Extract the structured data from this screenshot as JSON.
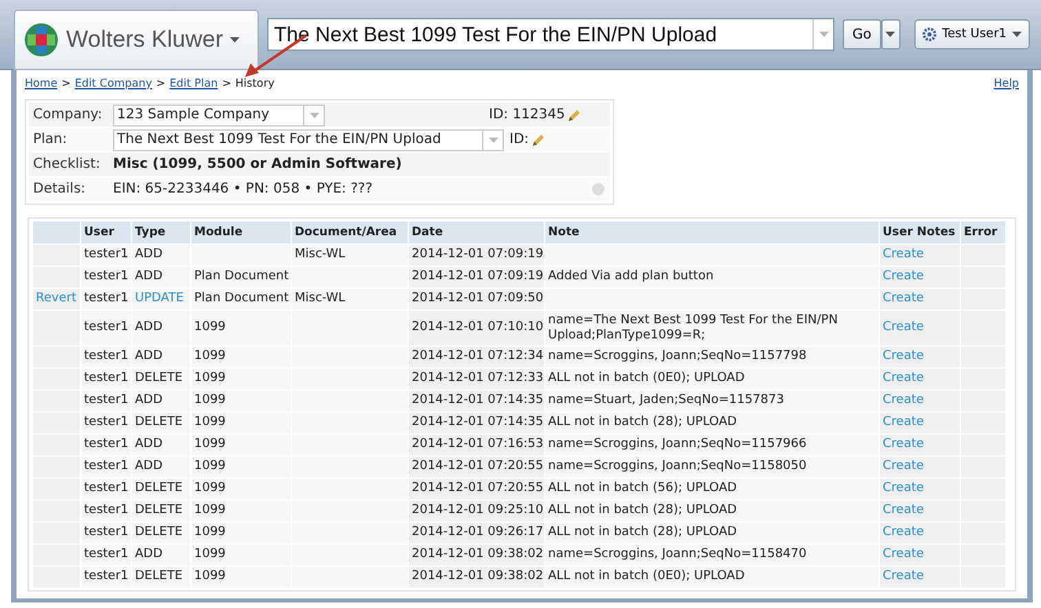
{
  "header": {
    "logo_text": "Wolters Kluwer",
    "plan_select": {
      "value": "The Next Best 1099 Test For the EIN/PN Upload"
    },
    "go_button": "Go",
    "user_menu": "Test User1"
  },
  "breadcrumb": {
    "links": [
      "Home",
      "Edit Company",
      "Edit Plan"
    ],
    "current": "History",
    "separator": ">"
  },
  "help_link": "Help",
  "info": {
    "company": {
      "label": "Company:",
      "value": "123 Sample Company",
      "id_label": "ID: 112345"
    },
    "plan": {
      "label": "Plan:",
      "value": "The Next Best 1099 Test For the EIN/PN Upload",
      "id_label": "ID:"
    },
    "checklist": {
      "label": "Checklist:",
      "value": "Misc (1099, 5500 or Admin Software)"
    },
    "details": {
      "label": "Details:",
      "value": "EIN: 65-2233446 • PN: 058 • PYE: ???"
    }
  },
  "table": {
    "columns": [
      "",
      "User",
      "Type",
      "Module",
      "Document/Area",
      "Date",
      "Note",
      "User Notes",
      "Error"
    ],
    "rows": [
      {
        "revert": "",
        "user": "tester1",
        "type": "ADD",
        "type_link": false,
        "module": "",
        "document": "Misc-WL",
        "date": "2014-12-01 07:09:19",
        "note": "",
        "user_notes": "Create"
      },
      {
        "revert": "",
        "user": "tester1",
        "type": "ADD",
        "type_link": false,
        "module": "Plan Document",
        "document": "",
        "date": "2014-12-01 07:09:19",
        "note": "Added Via add plan button",
        "user_notes": "Create"
      },
      {
        "revert": "Revert",
        "user": "tester1",
        "type": "UPDATE",
        "type_link": true,
        "module": "Plan Document",
        "document": "Misc-WL",
        "date": "2014-12-01 07:09:50",
        "note": "",
        "user_notes": "Create"
      },
      {
        "revert": "",
        "user": "tester1",
        "type": "ADD",
        "type_link": false,
        "module": "1099",
        "document": "",
        "date": "2014-12-01 07:10:10",
        "note": "name=The Next Best 1099 Test For the EIN/PN Upload;PlanType1099=R;",
        "user_notes": "Create"
      },
      {
        "revert": "",
        "user": "tester1",
        "type": "ADD",
        "type_link": false,
        "module": "1099",
        "document": "",
        "date": "2014-12-01 07:12:34",
        "note": "name=Scroggins, Joann;SeqNo=1157798",
        "user_notes": "Create"
      },
      {
        "revert": "",
        "user": "tester1",
        "type": "DELETE",
        "type_link": false,
        "module": "1099",
        "document": "",
        "date": "2014-12-01 07:12:33",
        "note": "ALL not in batch (0E0); UPLOAD",
        "user_notes": "Create"
      },
      {
        "revert": "",
        "user": "tester1",
        "type": "ADD",
        "type_link": false,
        "module": "1099",
        "document": "",
        "date": "2014-12-01 07:14:35",
        "note": "name=Stuart, Jaden;SeqNo=1157873",
        "user_notes": "Create"
      },
      {
        "revert": "",
        "user": "tester1",
        "type": "DELETE",
        "type_link": false,
        "module": "1099",
        "document": "",
        "date": "2014-12-01 07:14:35",
        "note": "ALL not in batch (28); UPLOAD",
        "user_notes": "Create"
      },
      {
        "revert": "",
        "user": "tester1",
        "type": "ADD",
        "type_link": false,
        "module": "1099",
        "document": "",
        "date": "2014-12-01 07:16:53",
        "note": "name=Scroggins, Joann;SeqNo=1157966",
        "user_notes": "Create"
      },
      {
        "revert": "",
        "user": "tester1",
        "type": "ADD",
        "type_link": false,
        "module": "1099",
        "document": "",
        "date": "2014-12-01 07:20:55",
        "note": "name=Scroggins, Joann;SeqNo=1158050",
        "user_notes": "Create"
      },
      {
        "revert": "",
        "user": "tester1",
        "type": "DELETE",
        "type_link": false,
        "module": "1099",
        "document": "",
        "date": "2014-12-01 07:20:55",
        "note": "ALL not in batch (56); UPLOAD",
        "user_notes": "Create"
      },
      {
        "revert": "",
        "user": "tester1",
        "type": "DELETE",
        "type_link": false,
        "module": "1099",
        "document": "",
        "date": "2014-12-01 09:25:10",
        "note": "ALL not in batch (28); UPLOAD",
        "user_notes": "Create"
      },
      {
        "revert": "",
        "user": "tester1",
        "type": "DELETE",
        "type_link": false,
        "module": "1099",
        "document": "",
        "date": "2014-12-01 09:26:17",
        "note": "ALL not in batch (28); UPLOAD",
        "user_notes": "Create"
      },
      {
        "revert": "",
        "user": "tester1",
        "type": "ADD",
        "type_link": false,
        "module": "1099",
        "document": "",
        "date": "2014-12-01 09:38:02",
        "note": "name=Scroggins, Joann;SeqNo=1158470",
        "user_notes": "Create"
      },
      {
        "revert": "",
        "user": "tester1",
        "type": "DELETE",
        "type_link": false,
        "module": "1099",
        "document": "",
        "date": "2014-12-01 09:38:02",
        "note": "ALL not in batch (0E0); UPLOAD",
        "user_notes": "Create"
      }
    ]
  }
}
